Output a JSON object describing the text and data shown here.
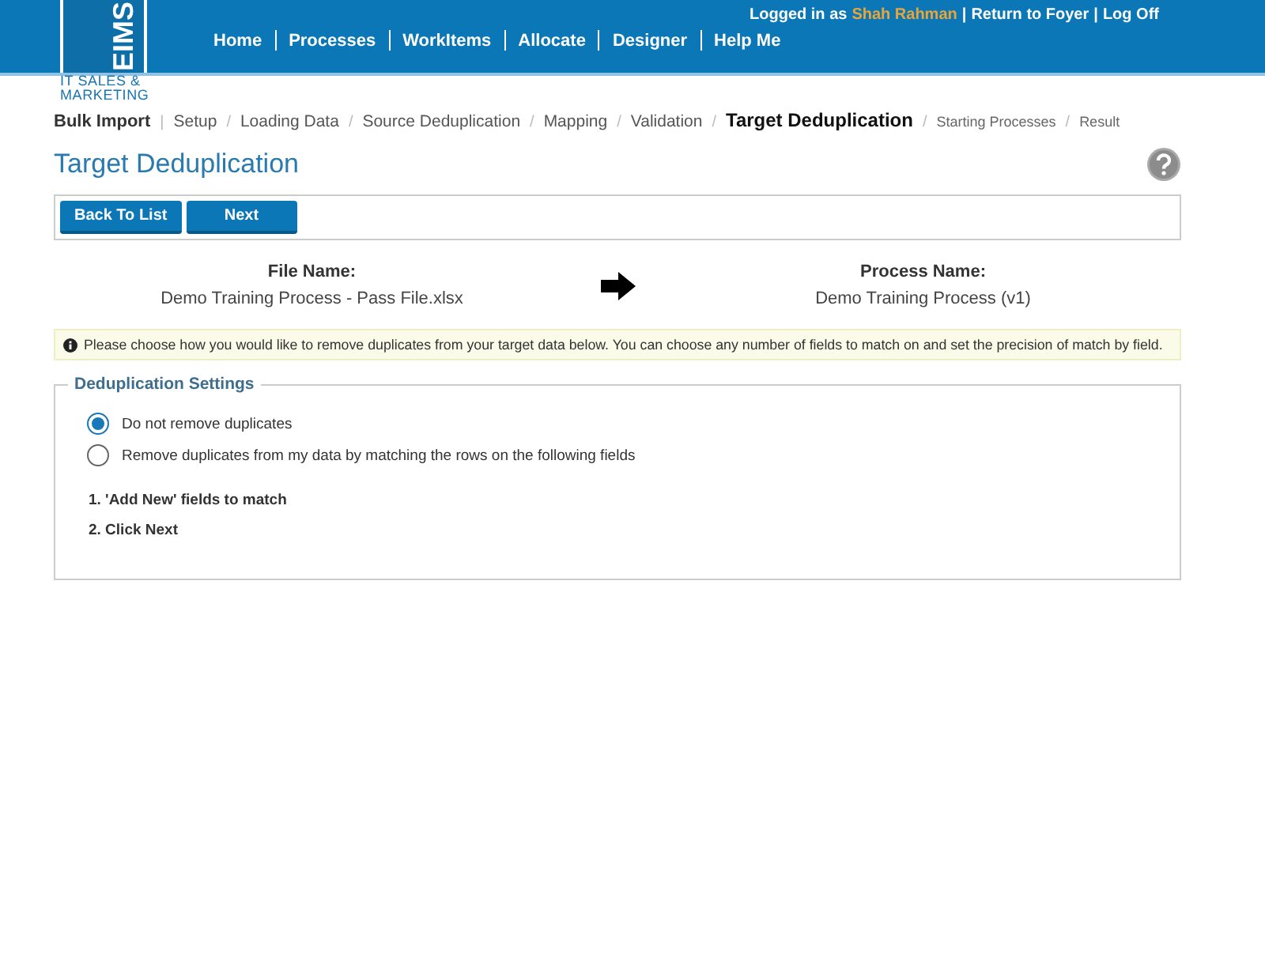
{
  "header": {
    "logo": {
      "mark": "EIMS",
      "tagline": "IT SALES & MARKETING"
    },
    "nav": [
      {
        "label": "Home"
      },
      {
        "label": "Processes"
      },
      {
        "label": "WorkItems"
      },
      {
        "label": "Allocate"
      },
      {
        "label": "Designer"
      },
      {
        "label": "Help Me"
      }
    ],
    "user_bar": {
      "prefix": "Logged in as",
      "user": "Shah Rahman",
      "links": [
        {
          "sep": "|",
          "label": "Return to Foyer"
        },
        {
          "sep": "|",
          "label": "Log Off"
        }
      ]
    }
  },
  "breadcrumbs": [
    {
      "label": "Bulk Import",
      "kind": "root"
    },
    {
      "label": "Setup",
      "sep": "|",
      "kind": "done"
    },
    {
      "label": "Loading Data",
      "sep": "/",
      "kind": "done"
    },
    {
      "label": "Source Deduplication",
      "sep": "/",
      "kind": "done"
    },
    {
      "label": "Mapping",
      "sep": "/",
      "kind": "done"
    },
    {
      "label": "Validation",
      "sep": "/",
      "kind": "done"
    },
    {
      "label": "Target Deduplication",
      "sep": "/",
      "kind": "current"
    },
    {
      "label": "Starting Processes",
      "sep": "/",
      "kind": "pending"
    },
    {
      "label": "Result",
      "sep": "/",
      "kind": "pending"
    }
  ],
  "page_title": "Target Deduplication",
  "toolbar": [
    "Back To List",
    "Next"
  ],
  "mapping": {
    "file_label": "File Name:",
    "file_value": "Demo Training Process - Pass File.xlsx",
    "process_label": "Process Name:",
    "process_value": "Demo Training Process (v1)"
  },
  "info": "Please choose how you would like to remove duplicates from your target data below. You can choose any number of fields to match on and set the precision of match by field.",
  "settings": {
    "legend": "Deduplication Settings",
    "options": [
      {
        "label": "Do not remove duplicates",
        "selected": true
      },
      {
        "label": "Remove duplicates from my data by matching the rows on the following fields",
        "selected": false
      }
    ],
    "steps": [
      "1. 'Add New' fields to match",
      "2. Click Next"
    ]
  }
}
